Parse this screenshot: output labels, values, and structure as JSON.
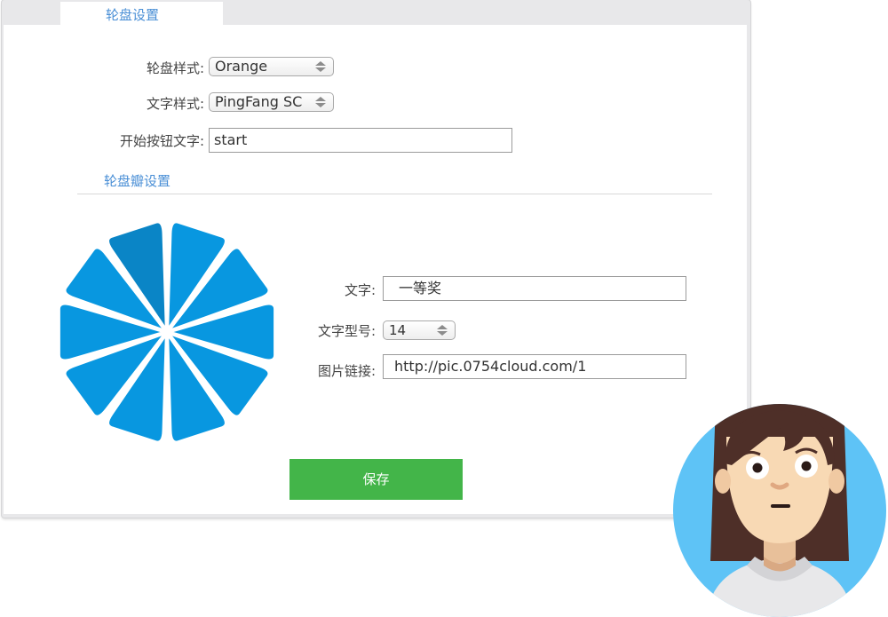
{
  "tab": {
    "label": "轮盘设置"
  },
  "form": {
    "wheel_style": {
      "label": "轮盘样式:",
      "value": "Orange"
    },
    "text_style": {
      "label": "文字样式:",
      "value": "PingFang SC"
    },
    "start_text": {
      "label": "开始按钮文字:",
      "value": "start"
    }
  },
  "segment_section": {
    "title": "轮盘瓣设置",
    "text": {
      "label": "文字:",
      "value": "一等奖"
    },
    "font_size": {
      "label": "文字型号:",
      "value": "14"
    },
    "image_link": {
      "label": "图片链接:",
      "value": "http://pic.0754cloud.com/1"
    }
  },
  "save_button": {
    "label": "保存"
  },
  "colors": {
    "accent": "#4a8fd6",
    "segment": "#0897e0",
    "segment_selected": "#0a85c6",
    "save": "#43b549",
    "avatar_bg": "#5ec3f6",
    "hair": "#4e2f28"
  },
  "wheel": {
    "segments": 10,
    "selected_index": 0
  }
}
